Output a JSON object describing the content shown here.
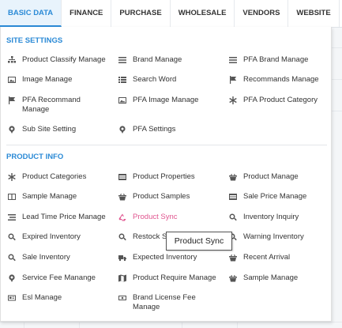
{
  "nav": {
    "tabs": [
      {
        "label": "BASIC DATA",
        "active": true
      },
      {
        "label": "FINANCE"
      },
      {
        "label": "PURCHASE"
      },
      {
        "label": "WHOLESALE"
      },
      {
        "label": "VENDORS"
      },
      {
        "label": "WEBSITE"
      },
      {
        "label": "F"
      }
    ]
  },
  "site_settings": {
    "title": "SITE SETTINGS",
    "items": [
      {
        "label": "Product Classify Manage",
        "icon": "sitemap-icon"
      },
      {
        "label": "Brand Manage",
        "icon": "bars-icon"
      },
      {
        "label": "PFA Brand Manage",
        "icon": "bars-icon"
      },
      {
        "label": "Image Manage",
        "icon": "image-icon"
      },
      {
        "label": "Search Word",
        "icon": "list-icon"
      },
      {
        "label": "Recommands Manage",
        "icon": "flag-icon"
      },
      {
        "label": "PFA Recommand Manage",
        "icon": "flag-icon"
      },
      {
        "label": "PFA Image Manage",
        "icon": "image-icon"
      },
      {
        "label": "PFA Product Category",
        "icon": "asterisk-icon"
      },
      {
        "label": "Sub Site Setting",
        "icon": "pin-icon"
      },
      {
        "label": "PFA Settings",
        "icon": "pin-icon"
      }
    ]
  },
  "product_info": {
    "title": "PRODUCT INFO",
    "items": [
      {
        "label": "Product Categories",
        "icon": "asterisk-icon"
      },
      {
        "label": "Product Properties",
        "icon": "table-icon"
      },
      {
        "label": "Product Manage",
        "icon": "basket-icon"
      },
      {
        "label": "Sample Manage",
        "icon": "columns-icon"
      },
      {
        "label": "Product Samples",
        "icon": "basket-icon"
      },
      {
        "label": "Sale Price Manage",
        "icon": "table-icon"
      },
      {
        "label": "Lead Time Price Manage",
        "icon": "list-icon"
      },
      {
        "label": "Product Sync",
        "icon": "recycle-icon"
      },
      {
        "label": "Inventory Inquiry",
        "icon": "search-icon"
      },
      {
        "label": "Expired Inventory",
        "icon": "search-icon"
      },
      {
        "label": "Restock S",
        "icon": "search-icon"
      },
      {
        "label": "Warning Inventory",
        "icon": "search-icon"
      },
      {
        "label": "Sale Inventory",
        "icon": "search-icon"
      },
      {
        "label": "Expected Inventory",
        "icon": "truck-icon"
      },
      {
        "label": "Recent Arrival",
        "icon": "basket-icon"
      },
      {
        "label": "Service Fee Manange",
        "icon": "pin-icon"
      },
      {
        "label": "Product Require Manage",
        "icon": "map-icon"
      },
      {
        "label": "Sample Manage",
        "icon": "basket-icon"
      },
      {
        "label": "Esl Manage",
        "icon": "card-icon"
      },
      {
        "label": "Brand License Fee Manage",
        "icon": "money-icon"
      }
    ]
  },
  "tooltip": {
    "text": "Product Sync"
  },
  "colors": {
    "accent": "#2b8ad6",
    "highlight": "#e0558f"
  }
}
